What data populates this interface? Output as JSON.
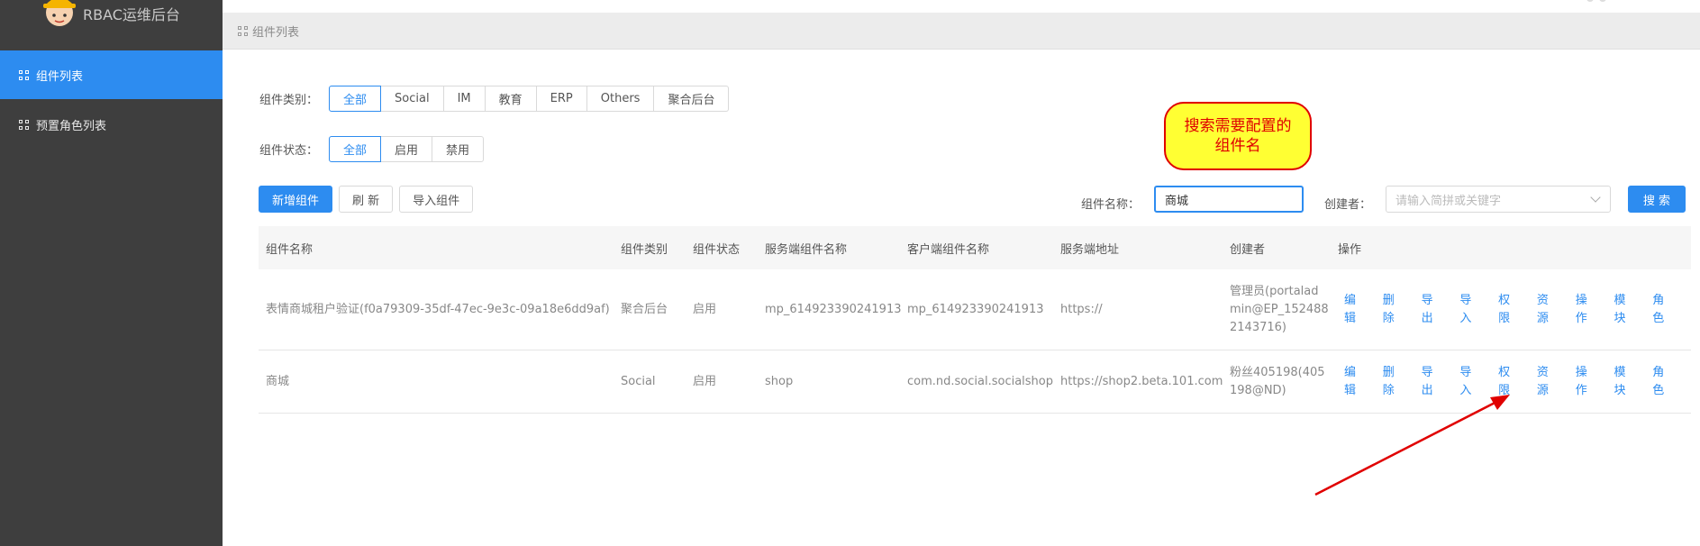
{
  "app": {
    "title": "RBAC运维后台",
    "logo_icon": "worker-helmet-avatar-icon"
  },
  "sidebar": {
    "items": [
      {
        "label": "组件列表",
        "icon": "grid-icon",
        "active": true
      },
      {
        "label": "预置角色列表",
        "icon": "grid-icon",
        "active": false
      }
    ]
  },
  "breadcrumb": {
    "label": "组件列表"
  },
  "filters": {
    "category": {
      "label": "组件类别：",
      "options": [
        "全部",
        "Social",
        "IM",
        "教育",
        "ERP",
        "Others",
        "聚合后台"
      ],
      "selected": "全部"
    },
    "status": {
      "label": "组件状态：",
      "options": [
        "全部",
        "启用",
        "禁用"
      ],
      "selected": "全部"
    }
  },
  "toolbar": {
    "add_label": "新增组件",
    "refresh_label": "刷 新",
    "import_label": "导入组件"
  },
  "search": {
    "name_label": "组件名称：",
    "name_value": "商城",
    "creator_label": "创建者：",
    "creator_placeholder": "请输入简拼或关键字",
    "button_label": "搜 索"
  },
  "callout": {
    "text_line1": "搜索需要配置的",
    "text_line2": "组件名"
  },
  "table": {
    "headers": [
      "组件名称",
      "组件类别",
      "组件状态",
      "服务端组件名称",
      "客户端组件名称",
      "服务端地址",
      "创建者",
      "操作"
    ],
    "rows": [
      {
        "name": "表情商城租户验证(f0a79309-35df-47ec-9e3c-09a18e6dd9af)",
        "category": "聚合后台",
        "status": "启用",
        "server_name": "mp_614923390241913",
        "client_name": "mp_614923390241913",
        "server_addr": "https://",
        "creator_l1": "管理员(portalad",
        "creator_l2": "min@EP_152488",
        "creator_l3": "2143716)"
      },
      {
        "name": "商城",
        "category": "Social",
        "status": "启用",
        "server_name": "shop",
        "client_name": "com.nd.social.socialshop",
        "server_addr": "https://shop2.beta.101.com",
        "creator_l1": "粉丝405198(405",
        "creator_l2": "198@ND)",
        "creator_l3": ""
      }
    ],
    "operations": [
      "编辑",
      "删除",
      "导出",
      "导入",
      "权限",
      "资源",
      "操作",
      "模块",
      "角色"
    ]
  },
  "colors": {
    "primary": "#2d8cf0",
    "sidebar": "#3e3e3e",
    "callout_bg": "#ffff33",
    "callout_border": "#e00000",
    "arrow": "#e00000"
  }
}
